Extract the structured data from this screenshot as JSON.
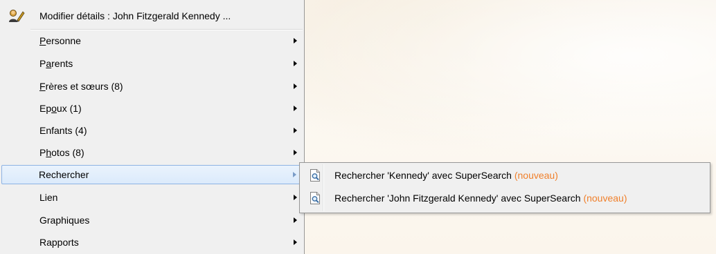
{
  "menu": {
    "header": {
      "label": "Modifier détails : John Fitzgerald Kennedy ...",
      "icon": "edit-person-icon"
    },
    "items": [
      {
        "pre": "",
        "key": "P",
        "post": "ersonne",
        "has_submenu": true
      },
      {
        "pre": "P",
        "key": "a",
        "post": "rents",
        "has_submenu": true
      },
      {
        "pre": "",
        "key": "F",
        "post": "rères et sœurs (8)",
        "has_submenu": true
      },
      {
        "pre": "Ep",
        "key": "o",
        "post": "ux (1)",
        "has_submenu": true
      },
      {
        "pre": "Enfants (4)",
        "key": "",
        "post": "",
        "has_submenu": true
      },
      {
        "pre": "P",
        "key": "h",
        "post": "otos (8)",
        "has_submenu": true
      },
      {
        "pre": "Rechercher",
        "key": "",
        "post": "",
        "has_submenu": true,
        "highlighted": true
      },
      {
        "pre": "Lien",
        "key": "",
        "post": "",
        "has_submenu": true
      },
      {
        "pre": "Graphiques",
        "key": "",
        "post": "",
        "has_submenu": true
      },
      {
        "pre": "Rapports",
        "key": "",
        "post": "",
        "has_submenu": true
      }
    ]
  },
  "submenu": {
    "items": [
      {
        "label": "Rechercher 'Kennedy' avec SuperSearch",
        "badge": "(nouveau)",
        "icon": "document-search-icon"
      },
      {
        "label": "Rechercher 'John Fitzgerald Kennedy' avec SuperSearch",
        "badge": "(nouveau)",
        "icon": "document-search-icon"
      }
    ]
  },
  "colors": {
    "menu_bg": "#f0f0f0",
    "highlight_border": "#8db2e3",
    "badge_orange": "#f07f2a"
  }
}
